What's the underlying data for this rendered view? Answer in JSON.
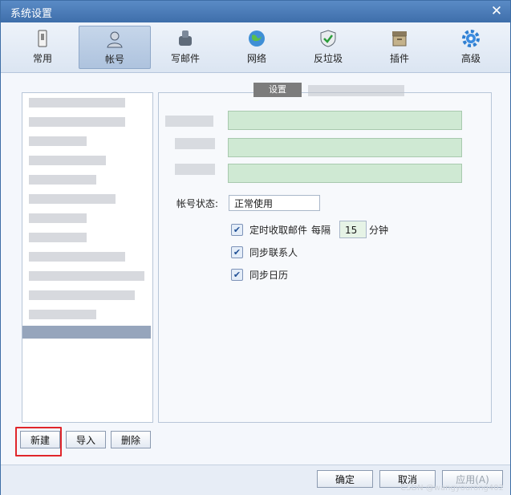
{
  "window": {
    "title": "系统设置",
    "close_glyph": "✕"
  },
  "toolbar": {
    "items": [
      {
        "label": "常用",
        "icon": "general-icon"
      },
      {
        "label": "帐号",
        "icon": "account-icon",
        "active": true
      },
      {
        "label": "写邮件",
        "icon": "compose-icon"
      },
      {
        "label": "网络",
        "icon": "network-icon"
      },
      {
        "label": "反垃圾",
        "icon": "antispam-icon"
      },
      {
        "label": "插件",
        "icon": "plugin-icon"
      },
      {
        "label": "高级",
        "icon": "advanced-icon"
      }
    ]
  },
  "detail": {
    "tab_label": "设置",
    "status_label": "帐号状态:",
    "status_value": "正常使用",
    "checks": [
      {
        "label": "定时收取邮件",
        "checked": true
      },
      {
        "label": "同步联系人",
        "checked": true
      },
      {
        "label": "同步日历",
        "checked": true
      }
    ],
    "interval_prefix": "每隔",
    "interval_value": "15",
    "interval_unit": "分钟"
  },
  "list_actions": {
    "new": "新建",
    "import": "导入",
    "delete": "删除"
  },
  "footer": {
    "ok": "确定",
    "cancel": "取消",
    "apply": "应用(A)"
  },
  "watermark": "CSDN @wangyourong402",
  "colors": {
    "accent": "#3e6eaa",
    "highlight": "#e0262b",
    "field_green": "#cfe9d3"
  }
}
